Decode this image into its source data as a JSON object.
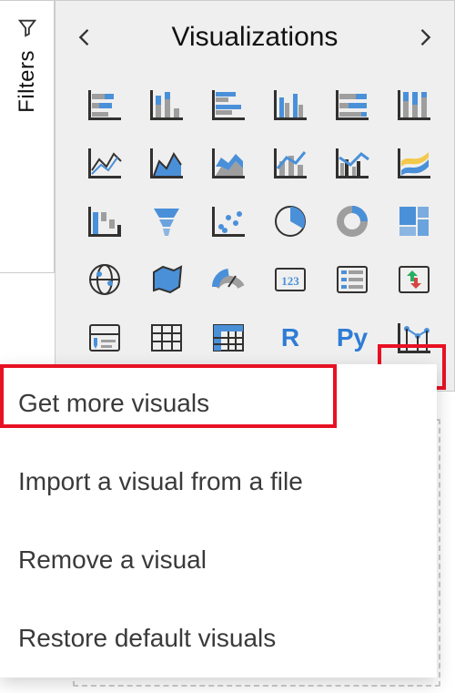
{
  "filters": {
    "label": "Filters",
    "icon": "funnel-icon"
  },
  "panel": {
    "title": "Visualizations",
    "collapse_icon": "chevron-left-icon",
    "expand_icon": "chevron-right-icon",
    "more_icon": "ellipsis-icon",
    "visuals": [
      {
        "name": "stacked-bar-chart"
      },
      {
        "name": "stacked-column-chart"
      },
      {
        "name": "clustered-bar-chart"
      },
      {
        "name": "clustered-column-chart"
      },
      {
        "name": "100-stacked-bar-chart"
      },
      {
        "name": "100-stacked-column-chart"
      },
      {
        "name": "line-chart"
      },
      {
        "name": "area-chart"
      },
      {
        "name": "stacked-area-chart"
      },
      {
        "name": "line-and-stacked-column-chart"
      },
      {
        "name": "line-and-clustered-column-chart"
      },
      {
        "name": "ribbon-chart"
      },
      {
        "name": "waterfall-chart"
      },
      {
        "name": "funnel-chart"
      },
      {
        "name": "scatter-chart"
      },
      {
        "name": "pie-chart"
      },
      {
        "name": "donut-chart"
      },
      {
        "name": "treemap"
      },
      {
        "name": "map"
      },
      {
        "name": "filled-map"
      },
      {
        "name": "gauge"
      },
      {
        "name": "card"
      },
      {
        "name": "multi-row-card"
      },
      {
        "name": "kpi"
      },
      {
        "name": "slicer"
      },
      {
        "name": "table"
      },
      {
        "name": "matrix"
      },
      {
        "name": "r-script-visual",
        "text": "R"
      },
      {
        "name": "python-visual",
        "text": "Py"
      },
      {
        "name": "key-influencers"
      }
    ]
  },
  "menu": {
    "items": [
      {
        "label": "Get more visuals",
        "action": "get-more-visuals"
      },
      {
        "label": "Import a visual from a file",
        "action": "import-visual-file"
      },
      {
        "label": "Remove a visual",
        "action": "remove-visual"
      },
      {
        "label": "Restore default visuals",
        "action": "restore-default-visuals"
      }
    ]
  },
  "colors": {
    "accent": "#4a90d9",
    "highlight": "#E81123"
  }
}
